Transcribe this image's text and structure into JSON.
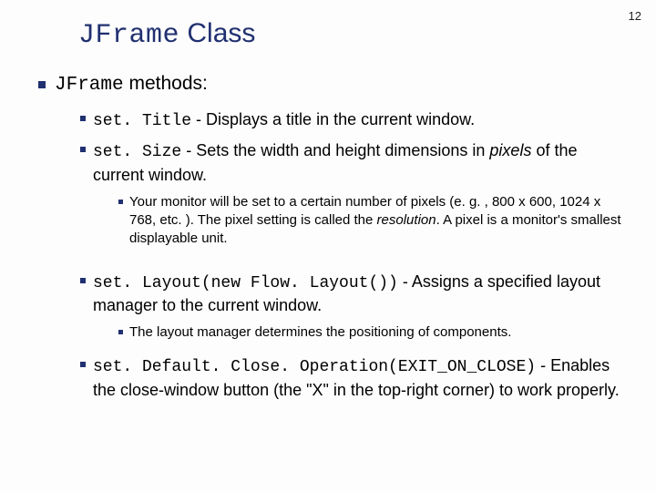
{
  "page_number": "12",
  "title": {
    "code": "JFrame",
    "rest": " Class"
  },
  "h1": {
    "code": "JFrame",
    "rest": " methods:"
  },
  "items": {
    "setTitle": {
      "code": "set. Title",
      "desc": " - Displays a title in the current window."
    },
    "setSize": {
      "code": "set. Size",
      "desc_a": " - Sets the width and height dimensions in ",
      "desc_em": "pixels",
      "desc_b": " of the current window."
    },
    "resolution": {
      "text_a": "Your monitor will be set to a certain number of pixels (e. g. , 800 x 600, 1024 x 768, etc. ). The pixel setting is called the ",
      "text_em": "resolution",
      "text_b": ". A pixel is a monitor's smallest displayable unit."
    },
    "setLayout": {
      "code": "set. Layout(new Flow. Layout())",
      "desc": " - Assigns a specified layout manager to the current window."
    },
    "layoutNote": {
      "text": "The layout manager determines the positioning of components."
    },
    "setDefaultClose": {
      "code": "set. Default. Close. Operation(EXIT_ON_CLOSE)",
      "desc": " - Enables the close-window button (the \"X\" in the top-right corner) to work properly."
    }
  }
}
